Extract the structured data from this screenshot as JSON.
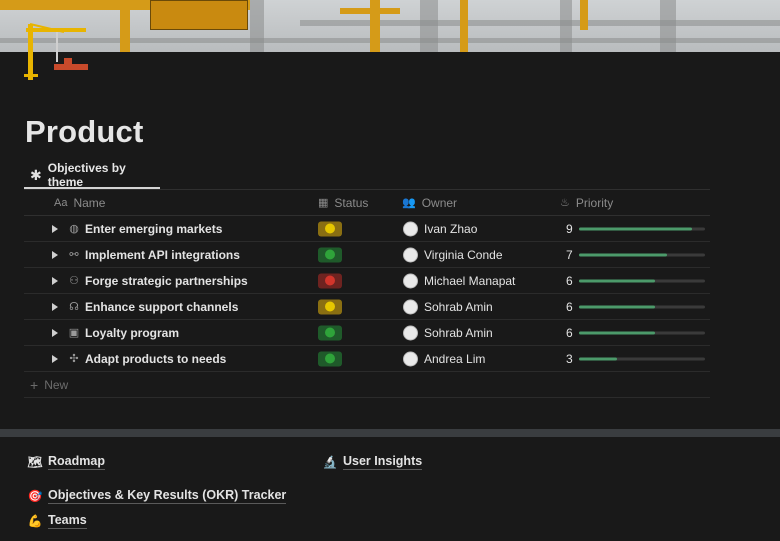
{
  "page": {
    "title": "Product"
  },
  "view_tab": {
    "label": "Objectives by theme",
    "icon": "asterisk-icon"
  },
  "table": {
    "columns": [
      {
        "key": "name",
        "label": "Name",
        "icon": "text-icon"
      },
      {
        "key": "status",
        "label": "Status",
        "icon": "traffic-light-icon"
      },
      {
        "key": "owner",
        "label": "Owner",
        "icon": "people-icon"
      },
      {
        "key": "priority",
        "label": "Priority",
        "icon": "flame-icon"
      }
    ],
    "rows": [
      {
        "name": "Enter emerging markets",
        "icon": "globe-icon",
        "status": "yellow",
        "owner": "Ivan Zhao",
        "priority": 9,
        "priority_fraction": 0.9
      },
      {
        "name": "Implement API integrations",
        "icon": "plug-icon",
        "status": "green",
        "owner": "Virginia Conde",
        "priority": 7,
        "priority_fraction": 0.7
      },
      {
        "name": "Forge strategic partnerships",
        "icon": "group-icon",
        "status": "red",
        "owner": "Michael Manapat",
        "priority": 6,
        "priority_fraction": 0.6
      },
      {
        "name": "Enhance support channels",
        "icon": "headset-icon",
        "status": "yellow",
        "owner": "Sohrab Amin",
        "priority": 6,
        "priority_fraction": 0.6
      },
      {
        "name": "Loyalty program",
        "icon": "gift-icon",
        "status": "green",
        "owner": "Sohrab Amin",
        "priority": 6,
        "priority_fraction": 0.6
      },
      {
        "name": "Adapt products to needs",
        "icon": "puzzle-icon",
        "status": "green",
        "owner": "Andrea Lim",
        "priority": 3,
        "priority_fraction": 0.3
      }
    ],
    "new_label": "New"
  },
  "status_colors": {
    "yellow": "#e6c700",
    "green": "#2fa33a",
    "red": "#d2352b"
  },
  "status_bg": {
    "yellow": "#8a6f12",
    "green": "#1f5a2a",
    "red": "#6e2320"
  },
  "links": [
    {
      "label": "Roadmap",
      "icon": "map-icon"
    },
    {
      "label": "User Insights",
      "icon": "microscope-icon"
    },
    {
      "label": "Objectives & Key Results (OKR) Tracker",
      "icon": "target-icon"
    },
    {
      "label": "Teams",
      "icon": "flexed-biceps-icon"
    }
  ]
}
